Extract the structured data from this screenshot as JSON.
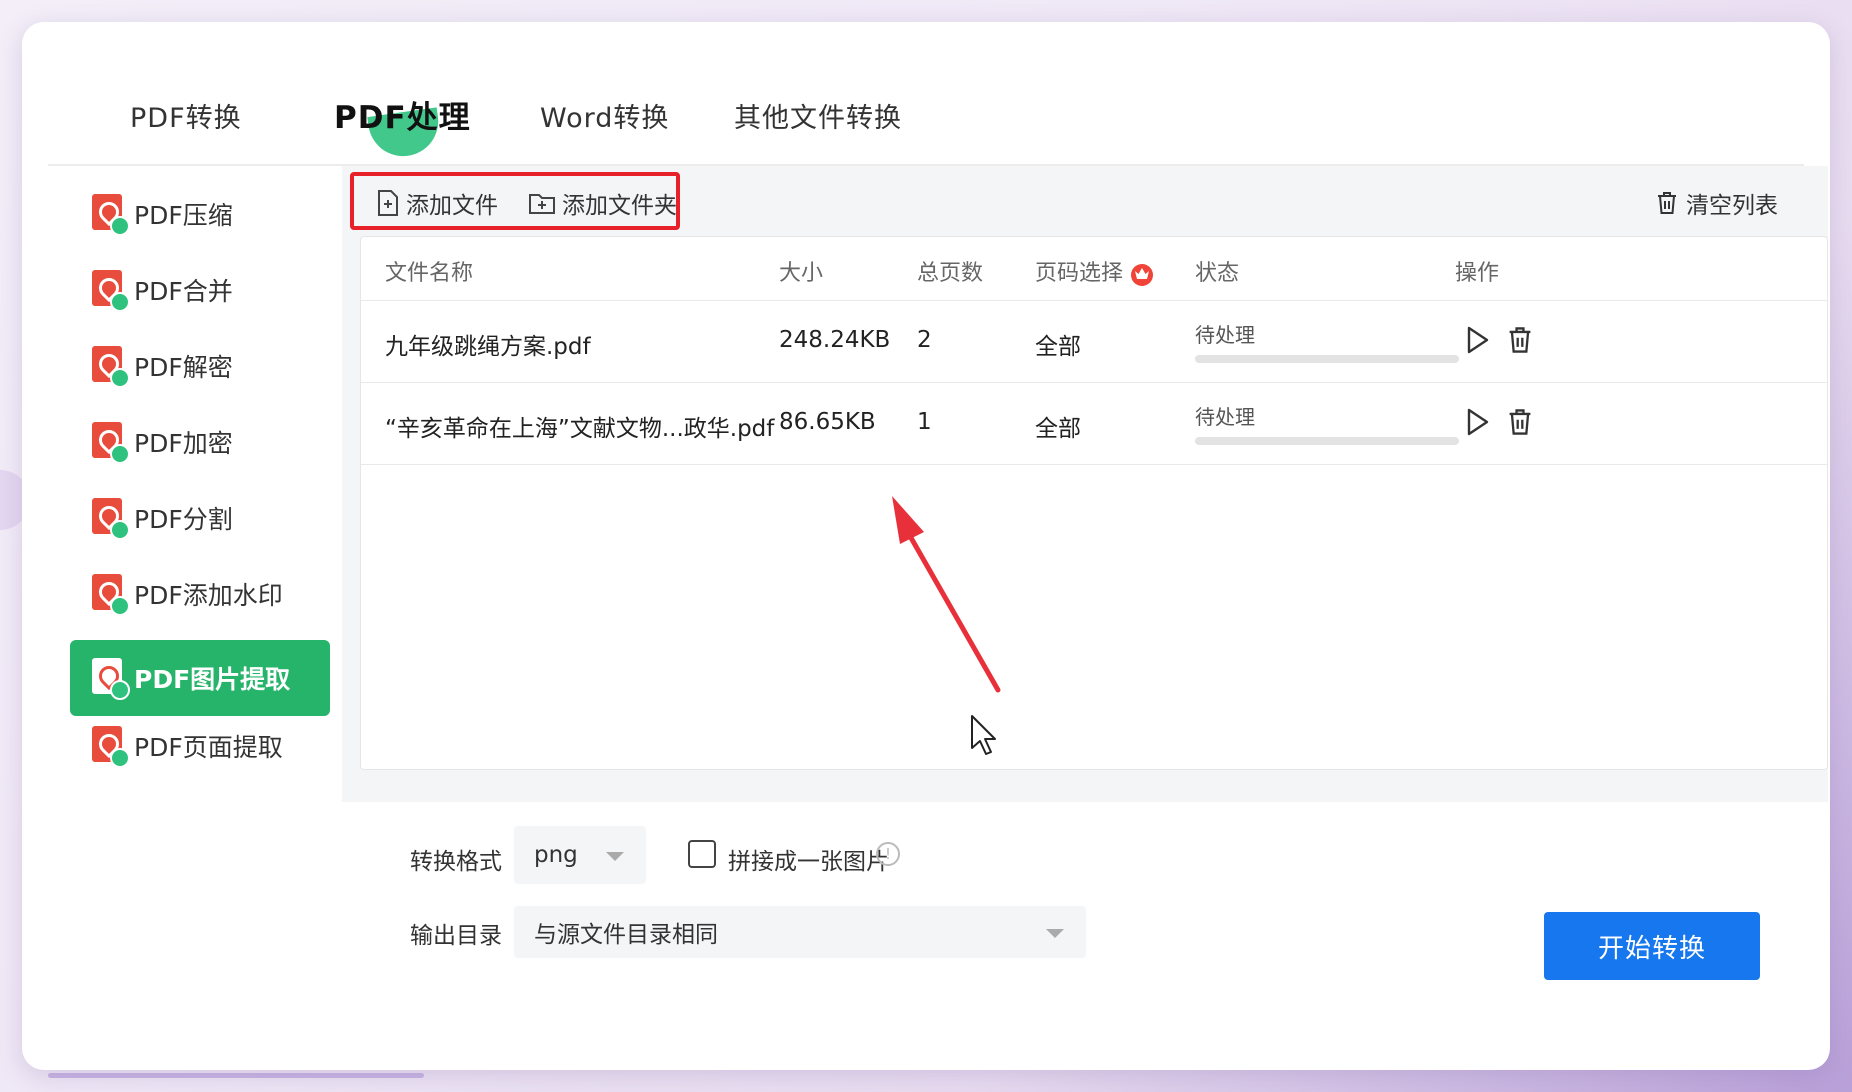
{
  "top_tabs": [
    "PDF转换",
    "PDF处理",
    "Word转换",
    "其他文件转换"
  ],
  "active_tab": "PDF处理",
  "sidebar": {
    "items": [
      {
        "label": "PDF压缩"
      },
      {
        "label": "PDF合并"
      },
      {
        "label": "PDF解密"
      },
      {
        "label": "PDF加密"
      },
      {
        "label": "PDF分割"
      },
      {
        "label": "PDF添加水印"
      },
      {
        "label": "PDF图片提取"
      },
      {
        "label": "PDF页面提取"
      }
    ],
    "active": "PDF图片提取"
  },
  "toolbar": {
    "add_file": "添加文件",
    "add_folder": "添加文件夹",
    "clear_list": "清空列表"
  },
  "table": {
    "headers": [
      "文件名称",
      "大小",
      "总页数",
      "页码选择",
      "状态",
      "操作"
    ],
    "rows": [
      {
        "name": "九年级跳绳方案.pdf",
        "size": "248.24KB",
        "pages": "2",
        "page_select": "全部",
        "status": "待处理",
        "progress": 0
      },
      {
        "name": "“辛亥革命在上海”文献文物...政华.pdf",
        "size": "86.65KB",
        "pages": "1",
        "page_select": "全部",
        "status": "待处理",
        "progress": 0
      }
    ]
  },
  "bottom": {
    "format_label": "转换格式",
    "format_value": "png",
    "merge_label": "拼接成一张图片",
    "merge_checked": false,
    "output_label": "输出目录",
    "output_value": "与源文件目录相同",
    "start_button": "开始转换"
  },
  "colors": {
    "accent_green": "#26b46a",
    "primary_blue": "#1677ee",
    "highlight_red": "#e8202a",
    "pdf_red": "#e74c3c"
  },
  "icons": [
    "add-file-icon",
    "add-folder-icon",
    "trash-icon",
    "play-icon",
    "crown-icon",
    "pdf-icon",
    "info-icon",
    "mouse-cursor-icon"
  ]
}
